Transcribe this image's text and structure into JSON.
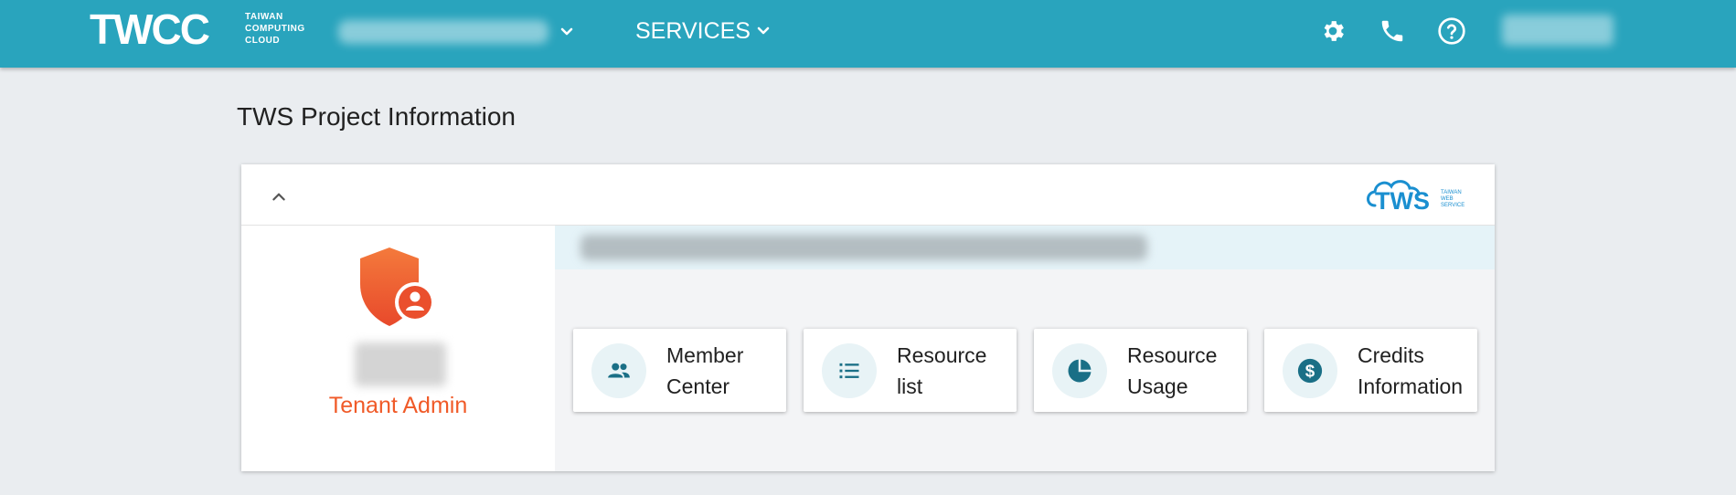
{
  "header": {
    "logo_initials": "TWCC",
    "logo_line1": "TAIWAN",
    "logo_line2": "COMPUTING",
    "logo_line3": "CLOUD",
    "services_label": "SERVICES"
  },
  "page": {
    "title": "TWS Project Information"
  },
  "card": {
    "tws_logo_text": "TWS",
    "tws_logo_sub1": "TAIWAN",
    "tws_logo_sub2": "WEB",
    "tws_logo_sub3": "SERVICE",
    "role": "Tenant Admin",
    "tiles": [
      {
        "line1": "Member",
        "line2": "Center",
        "icon": "people-icon"
      },
      {
        "line1": "Resource",
        "line2": "list",
        "icon": "list-icon"
      },
      {
        "line1": "Resource",
        "line2": "Usage",
        "icon": "pie-chart-icon"
      },
      {
        "line1": "Credits",
        "line2": "Information",
        "icon": "dollar-icon"
      }
    ]
  },
  "colors": {
    "topbar": "#29a4bd",
    "accent_teal": "#1a6f86",
    "role_orange": "#f05a28",
    "tile_icon_bg": "#e8f3f6",
    "tws_blue": "#1a8fd0"
  }
}
